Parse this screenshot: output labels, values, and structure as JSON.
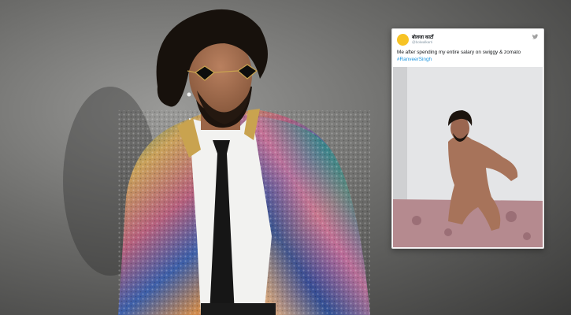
{
  "tweet": {
    "avatar_text": "",
    "display_name": "बोलजा कार्टो",
    "handle": "@bolwalkarti",
    "text": "Me after spending my entire salary on swiggy & zomato",
    "hashtag": "#RanveerSingh",
    "platform_icon": "twitter-bird-icon"
  },
  "colors": {
    "hashtag": "#1b95e0",
    "avatar_bg": "#f7c325",
    "background": "#6c6c6a"
  }
}
